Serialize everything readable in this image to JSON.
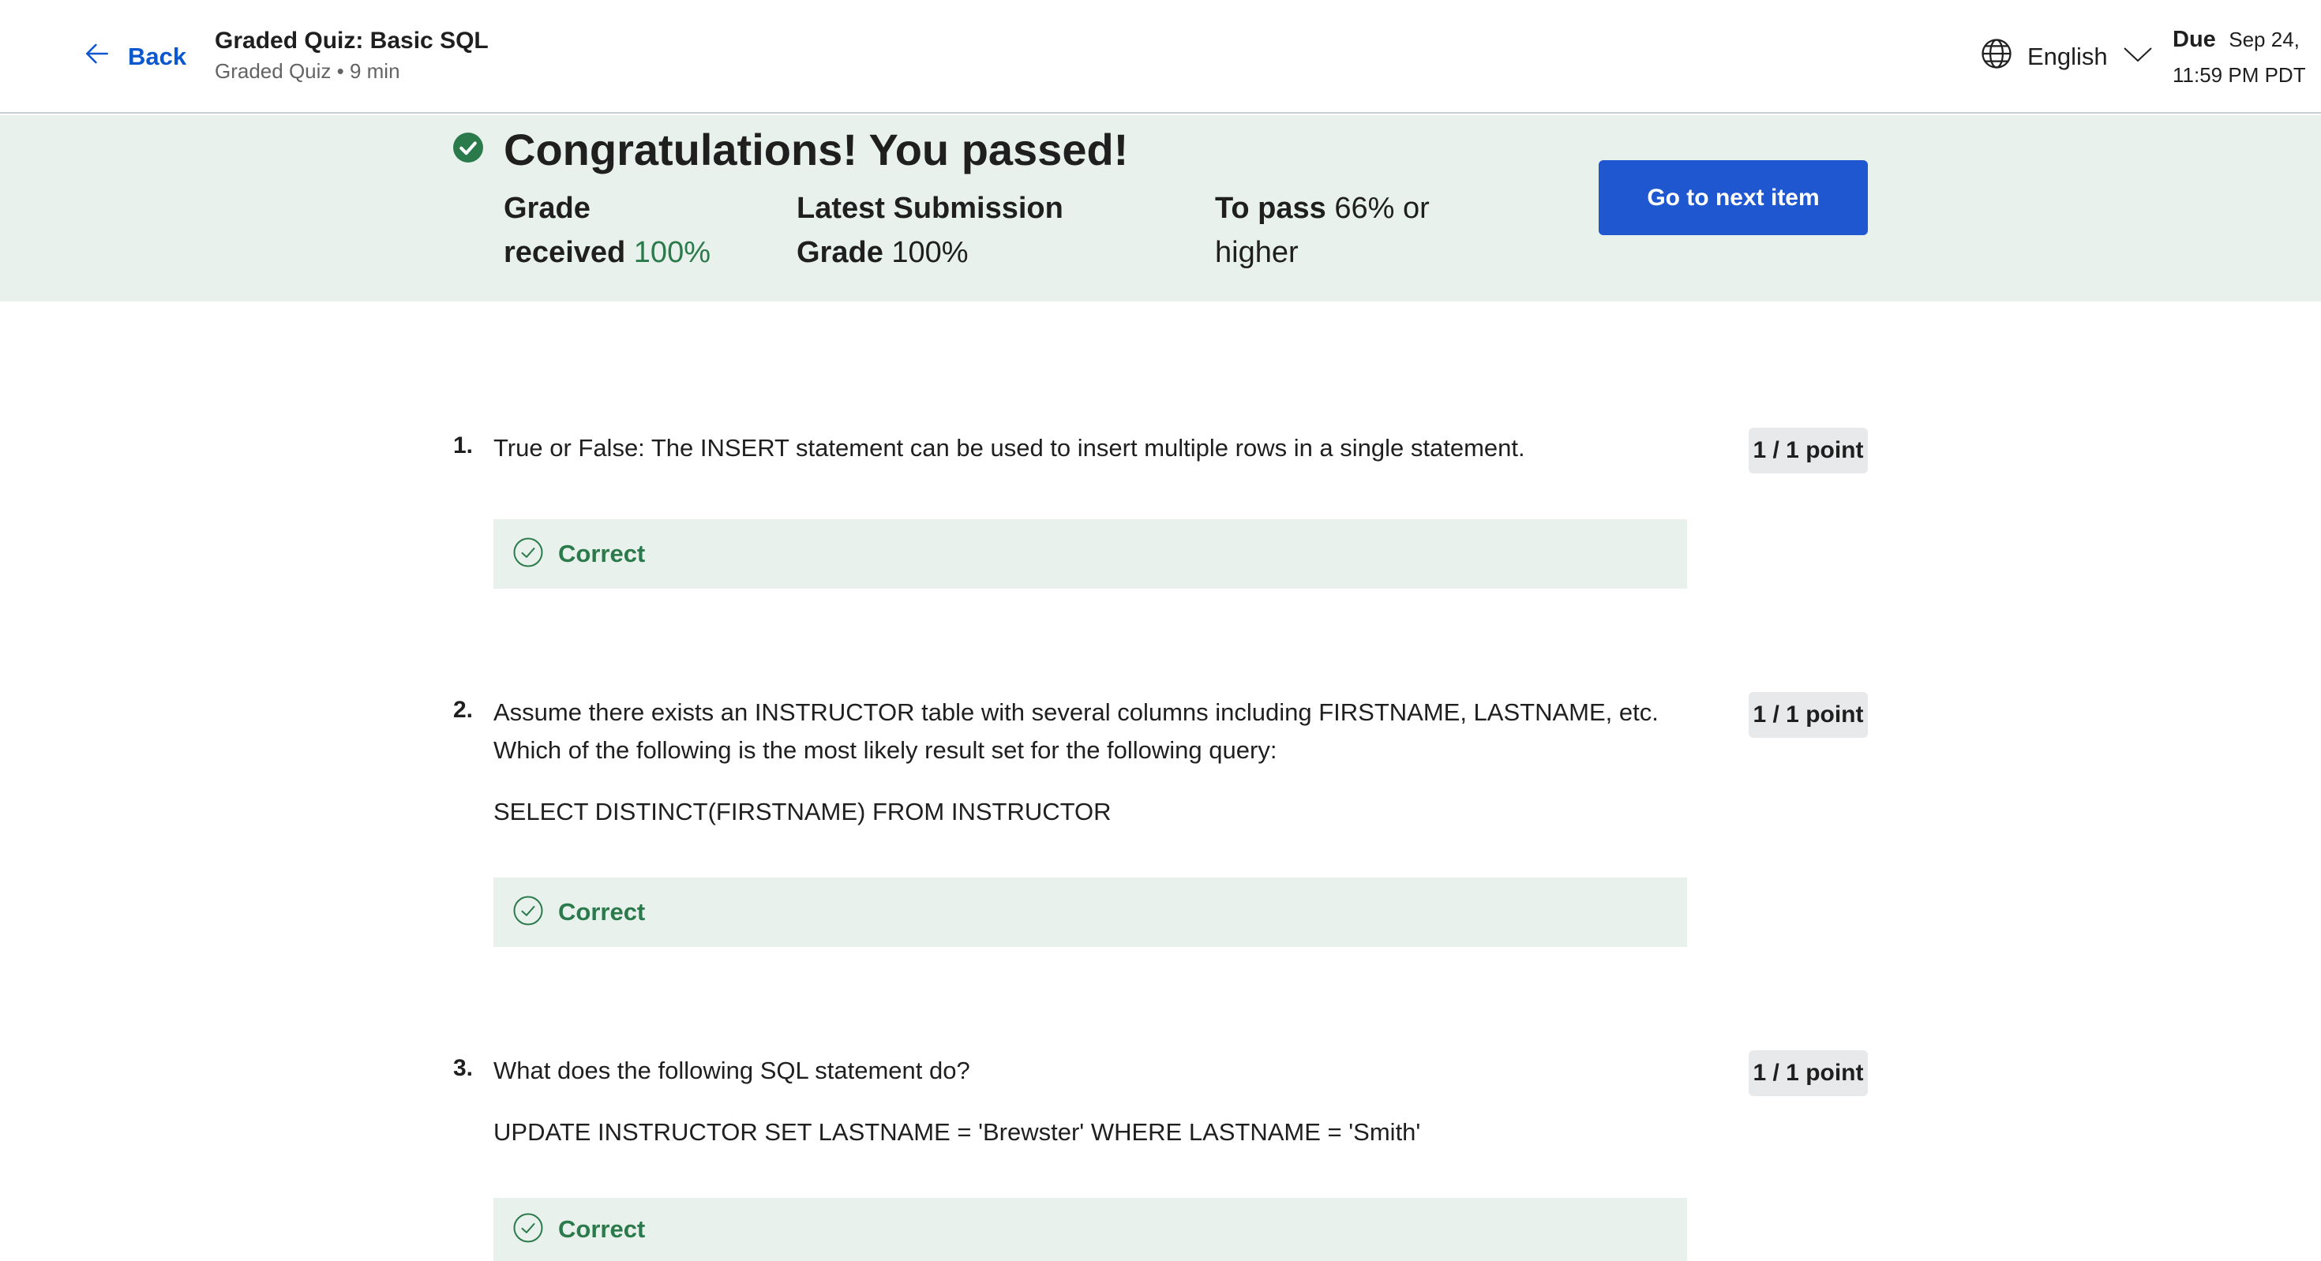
{
  "header": {
    "back_label": "Back",
    "title": "Graded Quiz: Basic SQL",
    "subtitle": "Graded Quiz • 9 min",
    "language": "English",
    "due_label": "Due",
    "due_date": "Sep 24,",
    "due_time": "11:59 PM PDT"
  },
  "banner": {
    "headline": "Congratulations! You passed!",
    "grade_label_1": "Grade",
    "grade_label_2": "received",
    "grade_value": "100%",
    "latest_label_1": "Latest Submission",
    "latest_label_2": "Grade",
    "latest_value": "100%",
    "pass_label": "To pass",
    "pass_value_1": "66% or",
    "pass_value_2": "higher",
    "next_button": "Go to next item"
  },
  "questions": [
    {
      "number": "1.",
      "text": "True or False: The INSERT statement can be used to insert multiple rows in a single statement.",
      "points": "1 / 1 point",
      "feedback": "Correct"
    },
    {
      "number": "2.",
      "text": "Assume there exists an INSTRUCTOR table with several columns including FIRSTNAME, LASTNAME, etc. Which of the following is the most likely result set for the following query:",
      "code": "SELECT DISTINCT(FIRSTNAME) FROM INSTRUCTOR",
      "points": "1 / 1 point",
      "feedback": "Correct"
    },
    {
      "number": "3.",
      "text": "What does the following SQL statement do?",
      "code": "UPDATE INSTRUCTOR SET LASTNAME = 'Brewster' WHERE LASTNAME = 'Smith'",
      "points": "1 / 1 point",
      "feedback": "Correct"
    }
  ],
  "colors": {
    "accent": "#1f57d1",
    "success": "#2b7a4b",
    "banner_bg": "#e8f1ec"
  },
  "icons": {
    "back": "arrow-left-icon",
    "language": "globe-icon",
    "dropdown": "chevron-down-icon",
    "passed": "check-circle-filled-icon",
    "correct": "check-circle-outline-icon"
  }
}
